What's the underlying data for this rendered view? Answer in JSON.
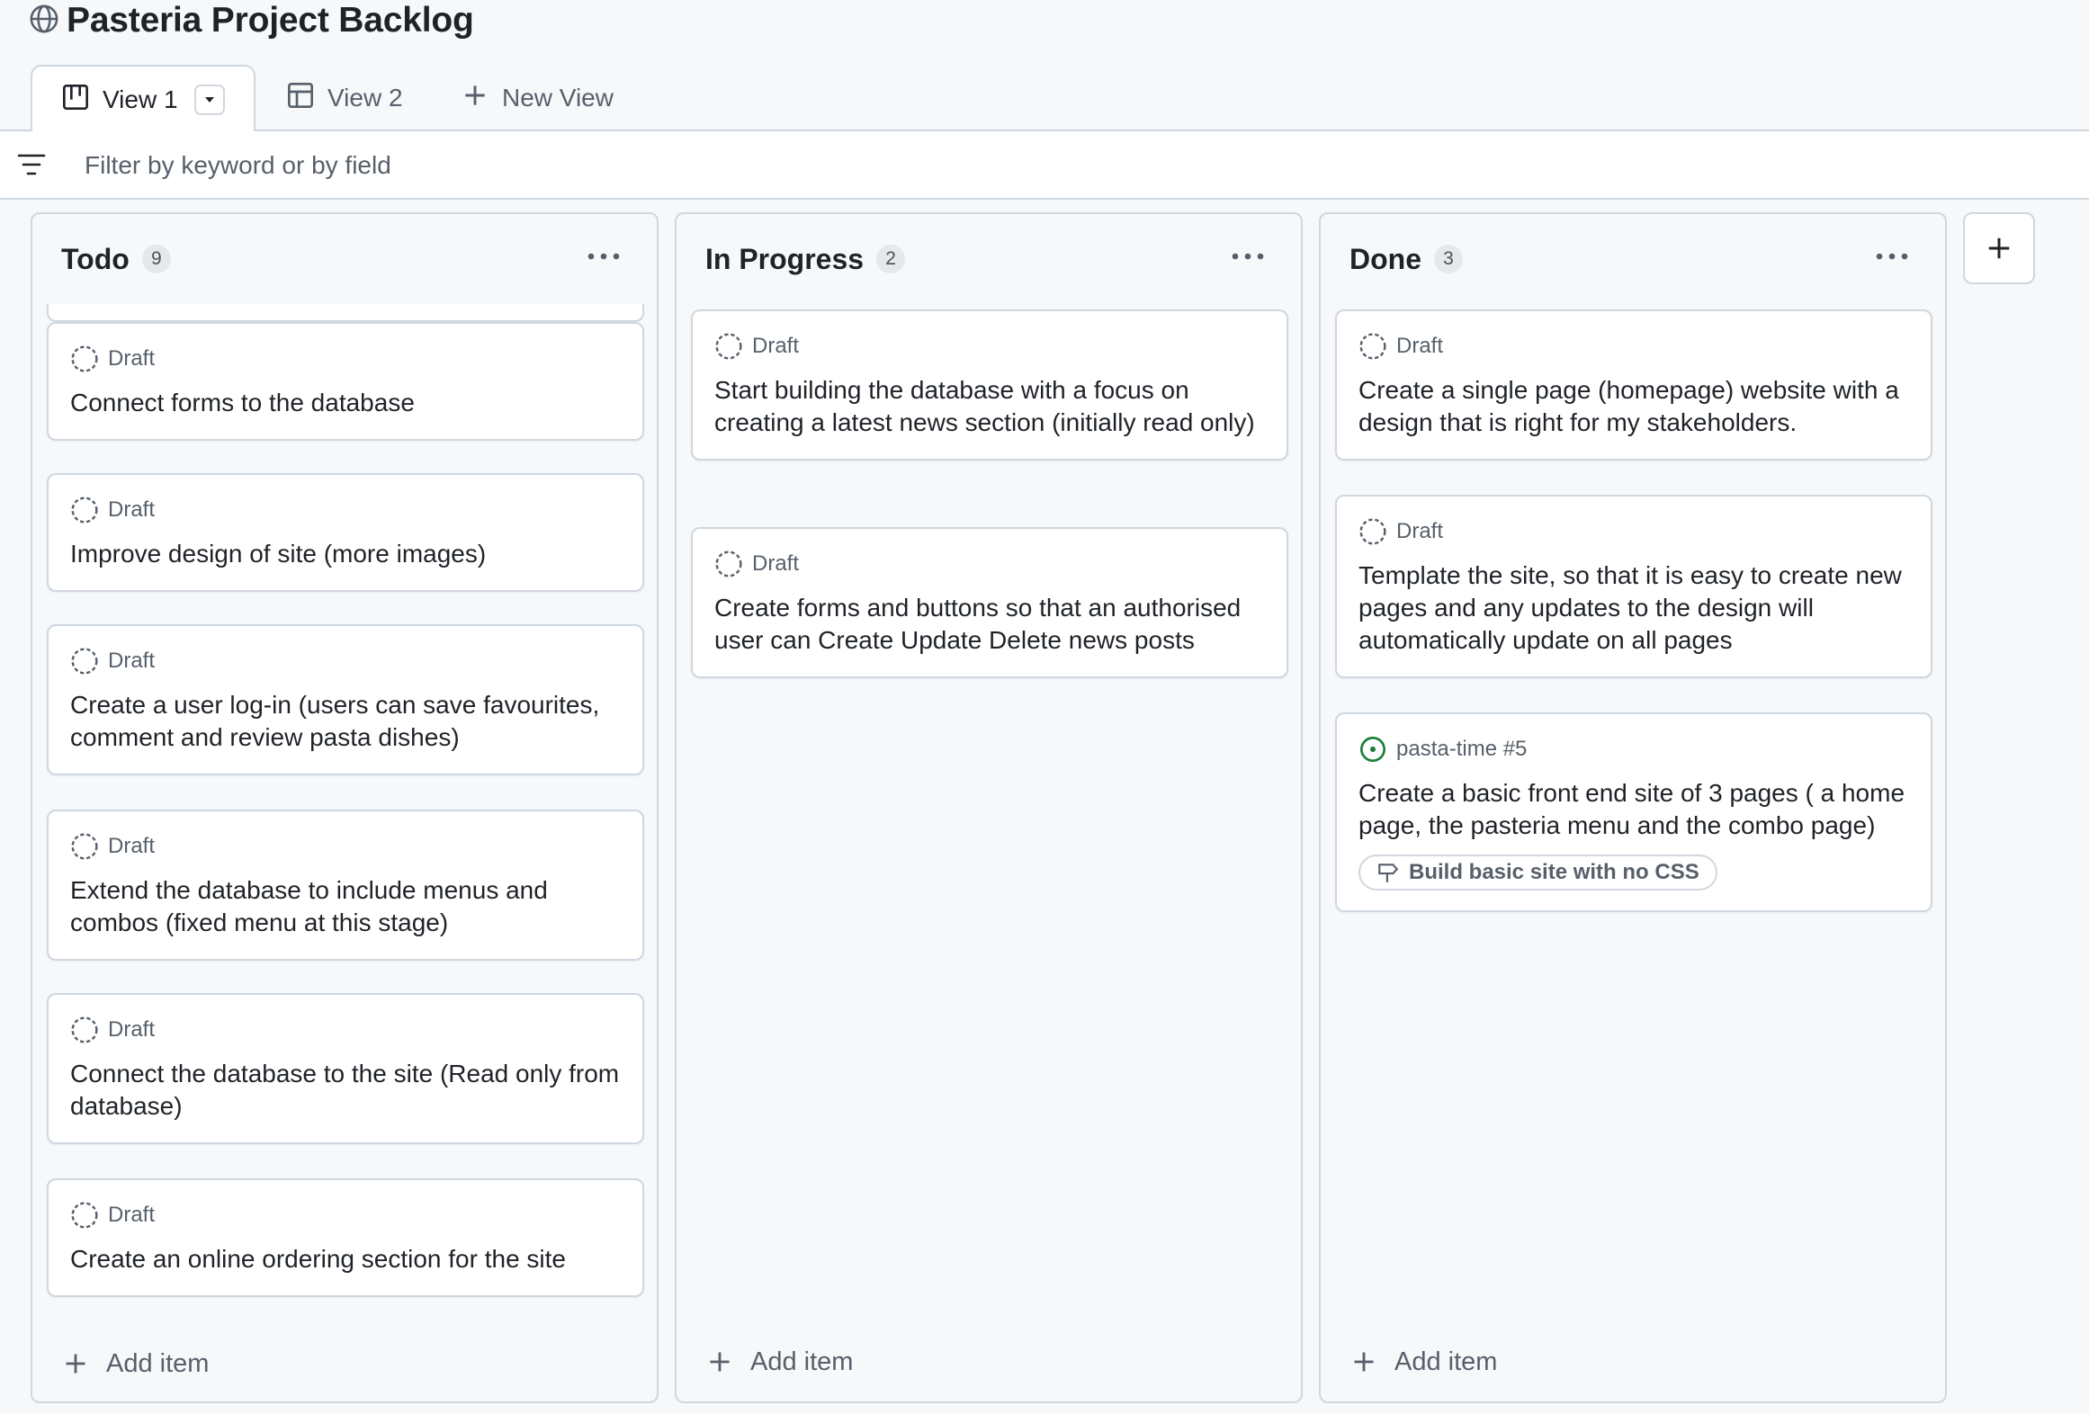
{
  "project": {
    "title": "Pasteria Project Backlog"
  },
  "tabs": [
    {
      "label": "View 1",
      "icon": "board-icon",
      "active": true
    },
    {
      "label": "View 2",
      "icon": "table-icon",
      "active": false
    },
    {
      "label": "New View",
      "icon": "plus-icon",
      "active": false
    }
  ],
  "filter": {
    "placeholder": "Filter by keyword or by field",
    "value": ""
  },
  "columns": [
    {
      "name": "Todo",
      "count": "9",
      "add_item_label": "Add item",
      "cards": [
        {
          "meta": "Draft",
          "title": "Connect forms to the database"
        },
        {
          "meta": "Draft",
          "title": "Improve design of site (more images)"
        },
        {
          "meta": "Draft",
          "title": "Create a user log-in (users can save favourites, comment and review pasta dishes)"
        },
        {
          "meta": "Draft",
          "title": "Extend the database to include menus and combos (fixed menu at this stage)"
        },
        {
          "meta": "Draft",
          "title": "Connect the database to the site (Read only from database)"
        },
        {
          "meta": "Draft",
          "title": "Create an online ordering section for the site"
        }
      ]
    },
    {
      "name": "In Progress",
      "count": "2",
      "add_item_label": "Add item",
      "cards": [
        {
          "meta": "Draft",
          "title": "Start building the database with a focus on creating a latest news section (initially read only)"
        },
        {
          "meta": "Draft",
          "title": "Create forms and buttons so that an authorised user can Create Update Delete news posts"
        }
      ]
    },
    {
      "name": "Done",
      "count": "3",
      "add_item_label": "Add item",
      "cards": [
        {
          "meta": "Draft",
          "title": "Create a single page (homepage) website with a design that is right for my stakeholders."
        },
        {
          "meta": "Draft",
          "title": "Template the site, so that it is easy to create new pages and any updates to the design will automatically update on all pages"
        },
        {
          "meta": "pasta-time #5",
          "title": "Create a basic front end site of 3 pages ( a home page, the pasteria menu and the combo page)",
          "label": "Build basic site with no CSS"
        }
      ]
    }
  ],
  "colors": {
    "issue_open": "#1a7f37",
    "border": "#d0d7de",
    "muted": "#57606a"
  }
}
